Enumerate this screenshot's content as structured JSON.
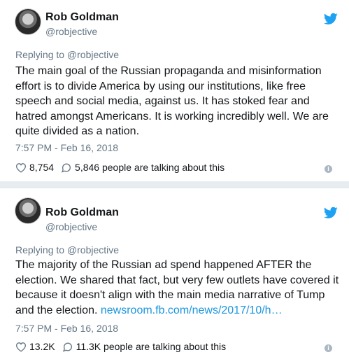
{
  "tweets": [
    {
      "author_name": "Rob Goldman",
      "author_handle": "@robjective",
      "replying_to": "Replying to @robjective",
      "text": "The main goal of the Russian propaganda and misinformation effort is to divide America by using our institutions, like free speech and social media, against us. It has stoked fear and hatred amongst Americans.  It is working incredibly well. We are quite divided as a nation.",
      "link": "",
      "timestamp": "7:57 PM - Feb 16, 2018",
      "likes": "8,754",
      "talking": "5,846 people are talking about this"
    },
    {
      "author_name": "Rob Goldman",
      "author_handle": "@robjective",
      "replying_to": "Replying to @robjective",
      "text": "The majority of the Russian ad spend happened AFTER the election.  We shared that fact, but very few outlets have covered it because it doesn't align with the main media narrative of Tump and the election. ",
      "link": "newsroom.fb.com/news/2017/10/h…",
      "timestamp": "7:57 PM - Feb 16, 2018",
      "likes": "13.2K",
      "talking": "11.3K people are talking about this"
    }
  ],
  "colors": {
    "twitter_blue": "#1da1f2",
    "link_blue": "#1b95e0",
    "muted_gray": "#657786"
  },
  "icons": {
    "bird": "twitter-bird-icon",
    "like": "heart-icon",
    "reply": "speech-bubble-icon",
    "info": "info-icon"
  }
}
